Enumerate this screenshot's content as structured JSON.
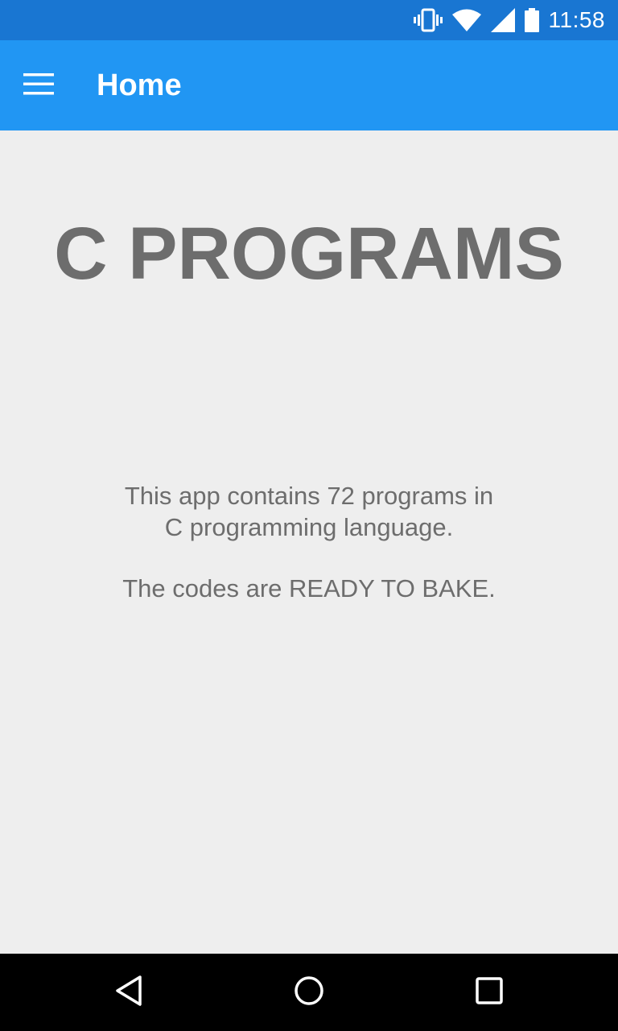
{
  "status_bar": {
    "time": "11:58",
    "icons": [
      "vibrate-icon",
      "wifi-icon",
      "signal-icon",
      "battery-icon"
    ],
    "background": "#1976d2"
  },
  "app_bar": {
    "title": "Home",
    "menu_icon": "hamburger-menu-icon",
    "background": "#2196f3"
  },
  "main": {
    "headline": "C PROGRAMS",
    "description_line1": "This app contains 72 programs in",
    "description_line2": "C programming language.",
    "tagline": "The codes are READY TO BAKE.",
    "text_color": "#6d6d6d",
    "background": "#eeeeee"
  },
  "navigation_bar": {
    "buttons": [
      "back-icon",
      "home-icon",
      "recents-icon"
    ],
    "background": "#000000"
  }
}
